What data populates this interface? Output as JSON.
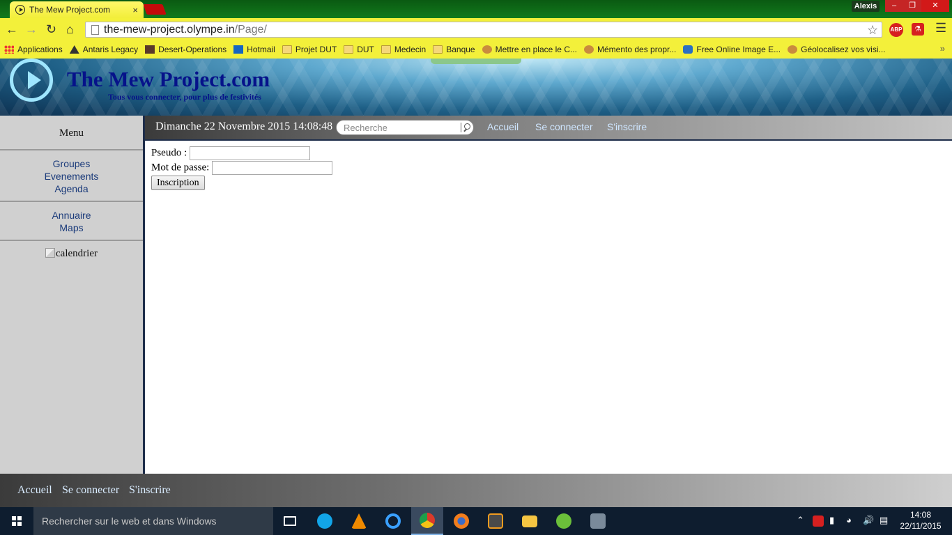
{
  "browser": {
    "tab_title": "The Mew Project.com",
    "tab_close": "×",
    "profile_name": "Alexis",
    "window_min": "–",
    "window_max": "❐",
    "window_close": "✕",
    "url_host": "the-mew-project.olympe.in",
    "url_path": "/Page/",
    "abp_label": "ABP",
    "bookmarks": [
      {
        "label": "Applications",
        "icon": "apps-grid-icon"
      },
      {
        "label": "Antaris Legacy",
        "icon": "antaris-icon"
      },
      {
        "label": "Desert-Operations",
        "icon": "desert-icon"
      },
      {
        "label": "Hotmail",
        "icon": "outlook-icon"
      },
      {
        "label": "Projet DUT",
        "icon": "folder-icon"
      },
      {
        "label": "DUT",
        "icon": "folder-icon"
      },
      {
        "label": "Medecin",
        "icon": "folder-icon"
      },
      {
        "label": "Banque",
        "icon": "folder-icon"
      },
      {
        "label": "Mettre en place le C...",
        "icon": "cookie-icon"
      },
      {
        "label": "Mémento des propr...",
        "icon": "cookie-icon"
      },
      {
        "label": "Free Online Image E...",
        "icon": "image-editor-icon"
      },
      {
        "label": "Géolocalisez vos visi...",
        "icon": "cookie-icon"
      }
    ],
    "bookmarks_more": "»"
  },
  "site": {
    "title": "The Mew Project.com",
    "tagline": "Tous vous connecter, pour plus de festivités"
  },
  "sidebar": {
    "title": "Menu",
    "group1": [
      "Groupes",
      "Evenements",
      "Agenda"
    ],
    "group2": [
      "Annuaire",
      "Maps"
    ],
    "calendar_alt": "calendrier"
  },
  "topnav": {
    "datetime": "Dimanche 22 Novembre 2015 14:08:48",
    "search_placeholder": "Recherche",
    "links": [
      "Accueil",
      "Se connecter",
      "S'inscrire"
    ]
  },
  "form": {
    "pseudo_label": "Pseudo :",
    "pseudo_value": "",
    "password_label": "Mot de passe:",
    "password_value": "",
    "submit_label": "Inscription"
  },
  "footer": {
    "links": [
      "Accueil",
      "Se connecter",
      "S'inscrire"
    ]
  },
  "taskbar": {
    "search_placeholder": "Rechercher sur le web et dans Windows",
    "apps": [
      "task-view",
      "skype",
      "vlc",
      "edge",
      "chrome",
      "firefox",
      "sublime-text",
      "file-explorer",
      "utorrent",
      "network-tool"
    ],
    "time": "14:08",
    "date": "22/11/2015"
  },
  "colors": {
    "tab_bg": "#f2ee3a",
    "site_title": "#06128a",
    "sidebar_bg": "#d0d0d0",
    "nav_link": "#cfe6ff",
    "taskbar_bg": "#0e1d2f"
  }
}
